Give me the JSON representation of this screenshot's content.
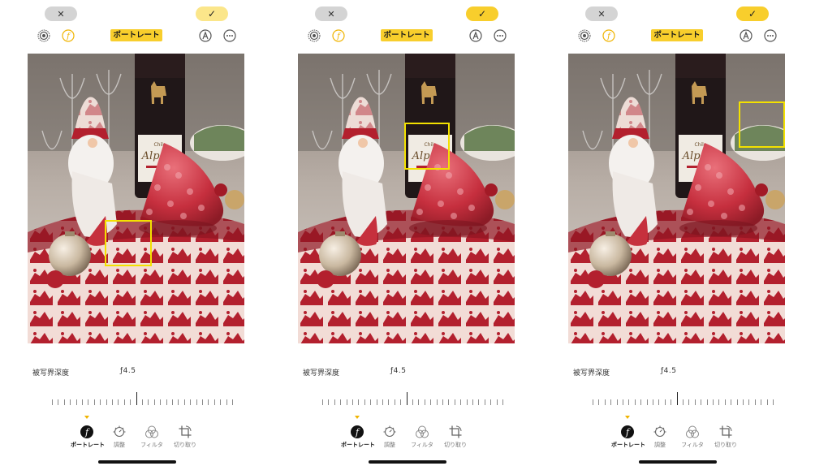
{
  "panels": [
    {
      "cancel_label": "✕",
      "done_label": "✓",
      "mode_label": "ポートレート",
      "depth_label": "被写界深度",
      "depth_value": "ƒ4.5",
      "focus_box": "bottom-left",
      "tools": [
        "ポートレート",
        "調整",
        "フィルタ",
        "切り取り"
      ]
    },
    {
      "cancel_label": "✕",
      "done_label": "✓",
      "mode_label": "ポートレート",
      "depth_label": "被写界深度",
      "depth_value": "ƒ4.5",
      "focus_box": "bottle-label",
      "tools": [
        "ポートレート",
        "調整",
        "フィルタ",
        "切り取り"
      ]
    },
    {
      "cancel_label": "✕",
      "done_label": "✓",
      "mode_label": "ポートレート",
      "depth_label": "被写界深度",
      "depth_value": "ƒ4.5",
      "focus_box": "top-right",
      "tools": [
        "ポートレート",
        "調整",
        "フィルタ",
        "切り取り"
      ]
    }
  ],
  "photo_text": {
    "bottle_brand": "Alpaca",
    "bottle_origin": "Chile"
  },
  "colors": {
    "accent": "#f8ce2c",
    "focus": "#f3e100"
  },
  "icons": [
    "close-icon",
    "checkmark-icon",
    "live-photo-icon",
    "f-stop-icon",
    "pen-markup-icon",
    "more-icon",
    "adjust-dial-icon",
    "filter-icon",
    "crop-icon"
  ]
}
